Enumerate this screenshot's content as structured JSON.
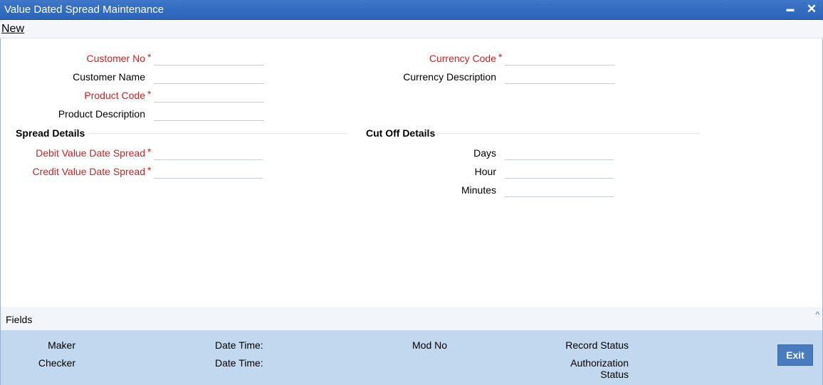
{
  "window": {
    "title": "Value Dated Spread Maintenance",
    "minimize_glyph": "▬",
    "close_glyph": "✕"
  },
  "toolbar": {
    "new_label": "New"
  },
  "form": {
    "required_marker": "*",
    "customer_no": {
      "label": "Customer No",
      "value": ""
    },
    "customer_name": {
      "label": "Customer Name",
      "value": ""
    },
    "product_code": {
      "label": "Product Code",
      "value": ""
    },
    "product_description": {
      "label": "Product Description",
      "value": ""
    },
    "currency_code": {
      "label": "Currency Code",
      "value": ""
    },
    "currency_description": {
      "label": "Currency Description",
      "value": ""
    }
  },
  "spread_details": {
    "title": "Spread Details",
    "debit_value_date_spread": {
      "label": "Debit Value Date Spread",
      "value": ""
    },
    "credit_value_date_spread": {
      "label": "Credit Value Date Spread",
      "value": ""
    }
  },
  "cut_off_details": {
    "title": "Cut Off Details",
    "days": {
      "label": "Days",
      "value": ""
    },
    "hour": {
      "label": "Hour",
      "value": ""
    },
    "minutes": {
      "label": "Minutes",
      "value": ""
    }
  },
  "fields_bar": {
    "label": "Fields",
    "caret_icon": "chevron-up-icon",
    "caret_glyph": "^"
  },
  "audit": {
    "maker_label": "Maker",
    "checker_label": "Checker",
    "date_time_label_1": "Date Time:",
    "date_time_label_2": "Date Time:",
    "mod_no_label": "Mod No",
    "record_status_label": "Record Status",
    "authorization_label_line1": "Authorization",
    "authorization_label_line2": "Status",
    "exit_label": "Exit"
  },
  "colors": {
    "title_bar": "#2a63b8",
    "required_label": "#cc2222",
    "audit_panel": "#c2d8ee",
    "exit_button": "#4a7bbf"
  }
}
